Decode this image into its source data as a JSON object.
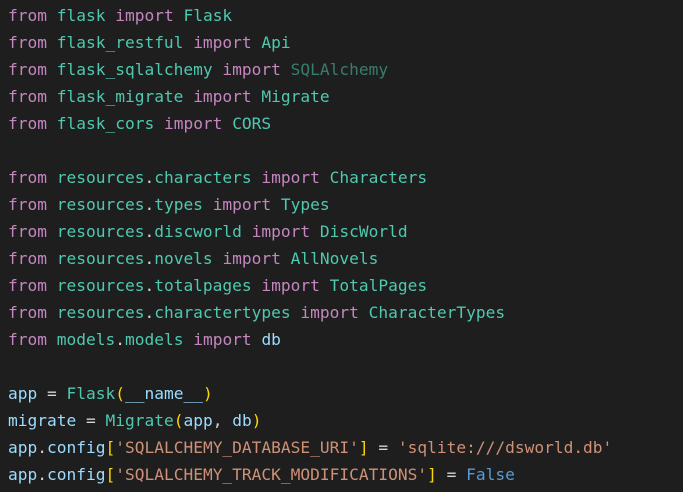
{
  "colors": {
    "background": "#1e1e1e",
    "keyword": "#c586c0",
    "module": "#4ec9b0",
    "class": "#4ec9b0",
    "variable": "#9cdcfe",
    "string": "#ce9178",
    "constant": "#569cd6",
    "plain": "#d4d4d4",
    "bracket_level1": "#ffd700",
    "bracket_level2": "#da70d6"
  },
  "code_lines": [
    [
      {
        "t": "from",
        "c": "keyword"
      },
      {
        "t": " ",
        "c": "plain"
      },
      {
        "t": "flask",
        "c": "module"
      },
      {
        "t": " ",
        "c": "plain"
      },
      {
        "t": "import",
        "c": "keyword"
      },
      {
        "t": " ",
        "c": "plain"
      },
      {
        "t": "Flask",
        "c": "class"
      }
    ],
    [
      {
        "t": "from",
        "c": "keyword"
      },
      {
        "t": " ",
        "c": "plain"
      },
      {
        "t": "flask_restful",
        "c": "module"
      },
      {
        "t": " ",
        "c": "plain"
      },
      {
        "t": "import",
        "c": "keyword"
      },
      {
        "t": " ",
        "c": "plain"
      },
      {
        "t": "Api",
        "c": "class"
      }
    ],
    [
      {
        "t": "from",
        "c": "keyword"
      },
      {
        "t": " ",
        "c": "plain"
      },
      {
        "t": "flask_sqlalchemy",
        "c": "module"
      },
      {
        "t": " ",
        "c": "plain"
      },
      {
        "t": "import",
        "c": "keyword"
      },
      {
        "t": " ",
        "c": "plain"
      },
      {
        "t": "SQLAlchemy",
        "c": "unused"
      }
    ],
    [
      {
        "t": "from",
        "c": "keyword"
      },
      {
        "t": " ",
        "c": "plain"
      },
      {
        "t": "flask_migrate",
        "c": "module"
      },
      {
        "t": " ",
        "c": "plain"
      },
      {
        "t": "import",
        "c": "keyword"
      },
      {
        "t": " ",
        "c": "plain"
      },
      {
        "t": "Migrate",
        "c": "class"
      }
    ],
    [
      {
        "t": "from",
        "c": "keyword"
      },
      {
        "t": " ",
        "c": "plain"
      },
      {
        "t": "flask_cors",
        "c": "module"
      },
      {
        "t": " ",
        "c": "plain"
      },
      {
        "t": "import",
        "c": "keyword"
      },
      {
        "t": " ",
        "c": "plain"
      },
      {
        "t": "CORS",
        "c": "class"
      }
    ],
    [],
    [
      {
        "t": "from",
        "c": "keyword"
      },
      {
        "t": " ",
        "c": "plain"
      },
      {
        "t": "resources",
        "c": "module"
      },
      {
        "t": ".",
        "c": "plain"
      },
      {
        "t": "characters",
        "c": "module"
      },
      {
        "t": " ",
        "c": "plain"
      },
      {
        "t": "import",
        "c": "keyword"
      },
      {
        "t": " ",
        "c": "plain"
      },
      {
        "t": "Characters",
        "c": "class"
      }
    ],
    [
      {
        "t": "from",
        "c": "keyword"
      },
      {
        "t": " ",
        "c": "plain"
      },
      {
        "t": "resources",
        "c": "module"
      },
      {
        "t": ".",
        "c": "plain"
      },
      {
        "t": "types",
        "c": "module"
      },
      {
        "t": " ",
        "c": "plain"
      },
      {
        "t": "import",
        "c": "keyword"
      },
      {
        "t": " ",
        "c": "plain"
      },
      {
        "t": "Types",
        "c": "class"
      }
    ],
    [
      {
        "t": "from",
        "c": "keyword"
      },
      {
        "t": " ",
        "c": "plain"
      },
      {
        "t": "resources",
        "c": "module"
      },
      {
        "t": ".",
        "c": "plain"
      },
      {
        "t": "discworld",
        "c": "module"
      },
      {
        "t": " ",
        "c": "plain"
      },
      {
        "t": "import",
        "c": "keyword"
      },
      {
        "t": " ",
        "c": "plain"
      },
      {
        "t": "DiscWorld",
        "c": "class"
      }
    ],
    [
      {
        "t": "from",
        "c": "keyword"
      },
      {
        "t": " ",
        "c": "plain"
      },
      {
        "t": "resources",
        "c": "module"
      },
      {
        "t": ".",
        "c": "plain"
      },
      {
        "t": "novels",
        "c": "module"
      },
      {
        "t": " ",
        "c": "plain"
      },
      {
        "t": "import",
        "c": "keyword"
      },
      {
        "t": " ",
        "c": "plain"
      },
      {
        "t": "AllNovels",
        "c": "class"
      }
    ],
    [
      {
        "t": "from",
        "c": "keyword"
      },
      {
        "t": " ",
        "c": "plain"
      },
      {
        "t": "resources",
        "c": "module"
      },
      {
        "t": ".",
        "c": "plain"
      },
      {
        "t": "totalpages",
        "c": "module"
      },
      {
        "t": " ",
        "c": "plain"
      },
      {
        "t": "import",
        "c": "keyword"
      },
      {
        "t": " ",
        "c": "plain"
      },
      {
        "t": "TotalPages",
        "c": "class"
      }
    ],
    [
      {
        "t": "from",
        "c": "keyword"
      },
      {
        "t": " ",
        "c": "plain"
      },
      {
        "t": "resources",
        "c": "module"
      },
      {
        "t": ".",
        "c": "plain"
      },
      {
        "t": "charactertypes",
        "c": "module"
      },
      {
        "t": " ",
        "c": "plain"
      },
      {
        "t": "import",
        "c": "keyword"
      },
      {
        "t": " ",
        "c": "plain"
      },
      {
        "t": "CharacterTypes",
        "c": "class"
      }
    ],
    [
      {
        "t": "from",
        "c": "keyword"
      },
      {
        "t": " ",
        "c": "plain"
      },
      {
        "t": "models",
        "c": "module"
      },
      {
        "t": ".",
        "c": "plain"
      },
      {
        "t": "models",
        "c": "module"
      },
      {
        "t": " ",
        "c": "plain"
      },
      {
        "t": "import",
        "c": "keyword"
      },
      {
        "t": " ",
        "c": "plain"
      },
      {
        "t": "db",
        "c": "var"
      }
    ],
    [],
    [
      {
        "t": "app",
        "c": "var"
      },
      {
        "t": " = ",
        "c": "plain"
      },
      {
        "t": "Flask",
        "c": "func"
      },
      {
        "t": "(",
        "c": "bracket"
      },
      {
        "t": "__name__",
        "c": "dunder"
      },
      {
        "t": ")",
        "c": "bracket"
      }
    ],
    [
      {
        "t": "migrate",
        "c": "var"
      },
      {
        "t": " = ",
        "c": "plain"
      },
      {
        "t": "Migrate",
        "c": "func"
      },
      {
        "t": "(",
        "c": "bracket"
      },
      {
        "t": "app",
        "c": "var"
      },
      {
        "t": ", ",
        "c": "plain"
      },
      {
        "t": "db",
        "c": "var"
      },
      {
        "t": ")",
        "c": "bracket"
      }
    ],
    [
      {
        "t": "app",
        "c": "var"
      },
      {
        "t": ".",
        "c": "plain"
      },
      {
        "t": "config",
        "c": "var"
      },
      {
        "t": "[",
        "c": "bracket"
      },
      {
        "t": "'SQLALCHEMY_DATABASE_URI'",
        "c": "str"
      },
      {
        "t": "]",
        "c": "bracket"
      },
      {
        "t": " = ",
        "c": "plain"
      },
      {
        "t": "'sqlite:///dsworld.db'",
        "c": "str"
      }
    ],
    [
      {
        "t": "app",
        "c": "var"
      },
      {
        "t": ".",
        "c": "plain"
      },
      {
        "t": "config",
        "c": "var"
      },
      {
        "t": "[",
        "c": "bracket"
      },
      {
        "t": "'SQLALCHEMY_TRACK_MODIFICATIONS'",
        "c": "str"
      },
      {
        "t": "]",
        "c": "bracket"
      },
      {
        "t": " = ",
        "c": "plain"
      },
      {
        "t": "False",
        "c": "const"
      }
    ]
  ]
}
